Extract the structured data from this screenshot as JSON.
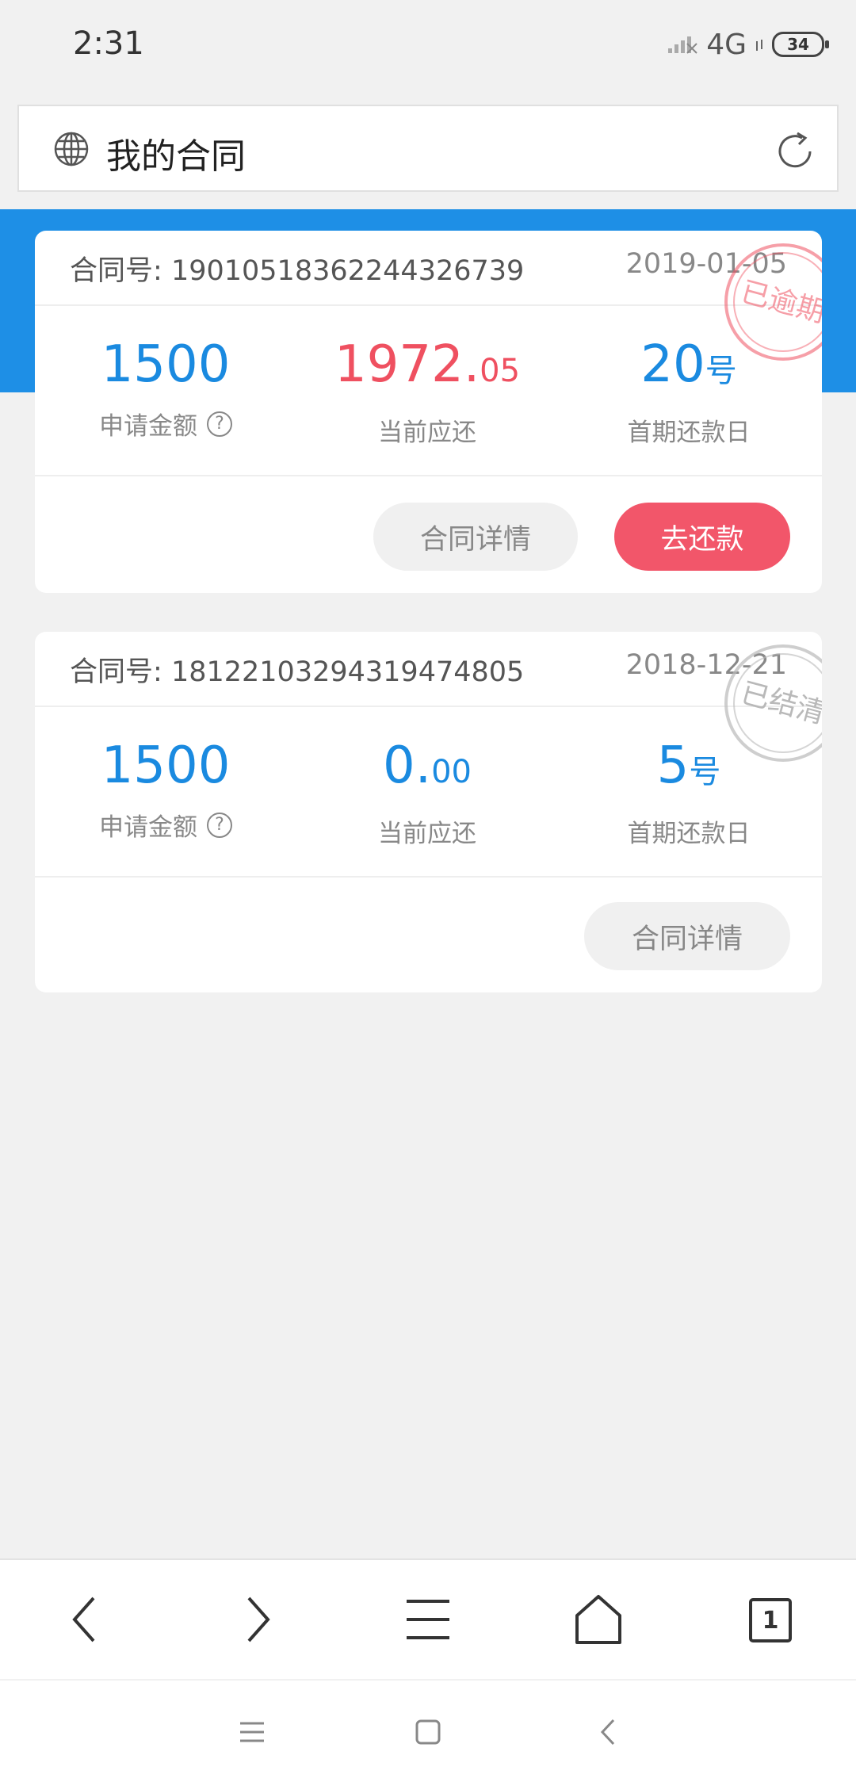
{
  "status_bar": {
    "time": "2:31",
    "network": "4G",
    "battery": "34"
  },
  "address_bar": {
    "title": "我的合同"
  },
  "contracts": [
    {
      "contract_label": "合同号",
      "contract_no": "19010518362244326739",
      "date": "2019-01-05",
      "stamp": "已逾期",
      "stamp_color": "#ef5060",
      "applied_amount": "1500",
      "applied_label": "申请金额",
      "current_due_int": "1972.",
      "current_due_dec": "05",
      "current_due_label": "当前应还",
      "first_due_day": "20",
      "first_due_day_unit": "号",
      "first_due_day_label": "首期还款日",
      "detail_button": "合同详情",
      "pay_button": "去还款"
    },
    {
      "contract_label": "合同号",
      "contract_no": "18122103294319474805",
      "date": "2018-12-21",
      "stamp": "已结清",
      "stamp_color": "#b9b9b9",
      "applied_amount": "1500",
      "applied_label": "申请金额",
      "current_due_int": "0.",
      "current_due_dec": "00",
      "current_due_label": "当前应还",
      "first_due_day": "5",
      "first_due_day_unit": "号",
      "first_due_day_label": "首期还款日",
      "detail_button": "合同详情"
    }
  ],
  "browser_nav": {
    "icons": [
      "back-icon",
      "forward-icon",
      "menu-icon",
      "home-icon",
      "tabs-icon"
    ],
    "tab_count": "1"
  },
  "system_nav": {
    "icons": [
      "recents-icon",
      "home-square-icon",
      "back-chevron-icon"
    ]
  },
  "colors": {
    "accent_blue": "#1e8fe6",
    "accent_red": "#f2566a",
    "background": "#f1f1f1"
  }
}
